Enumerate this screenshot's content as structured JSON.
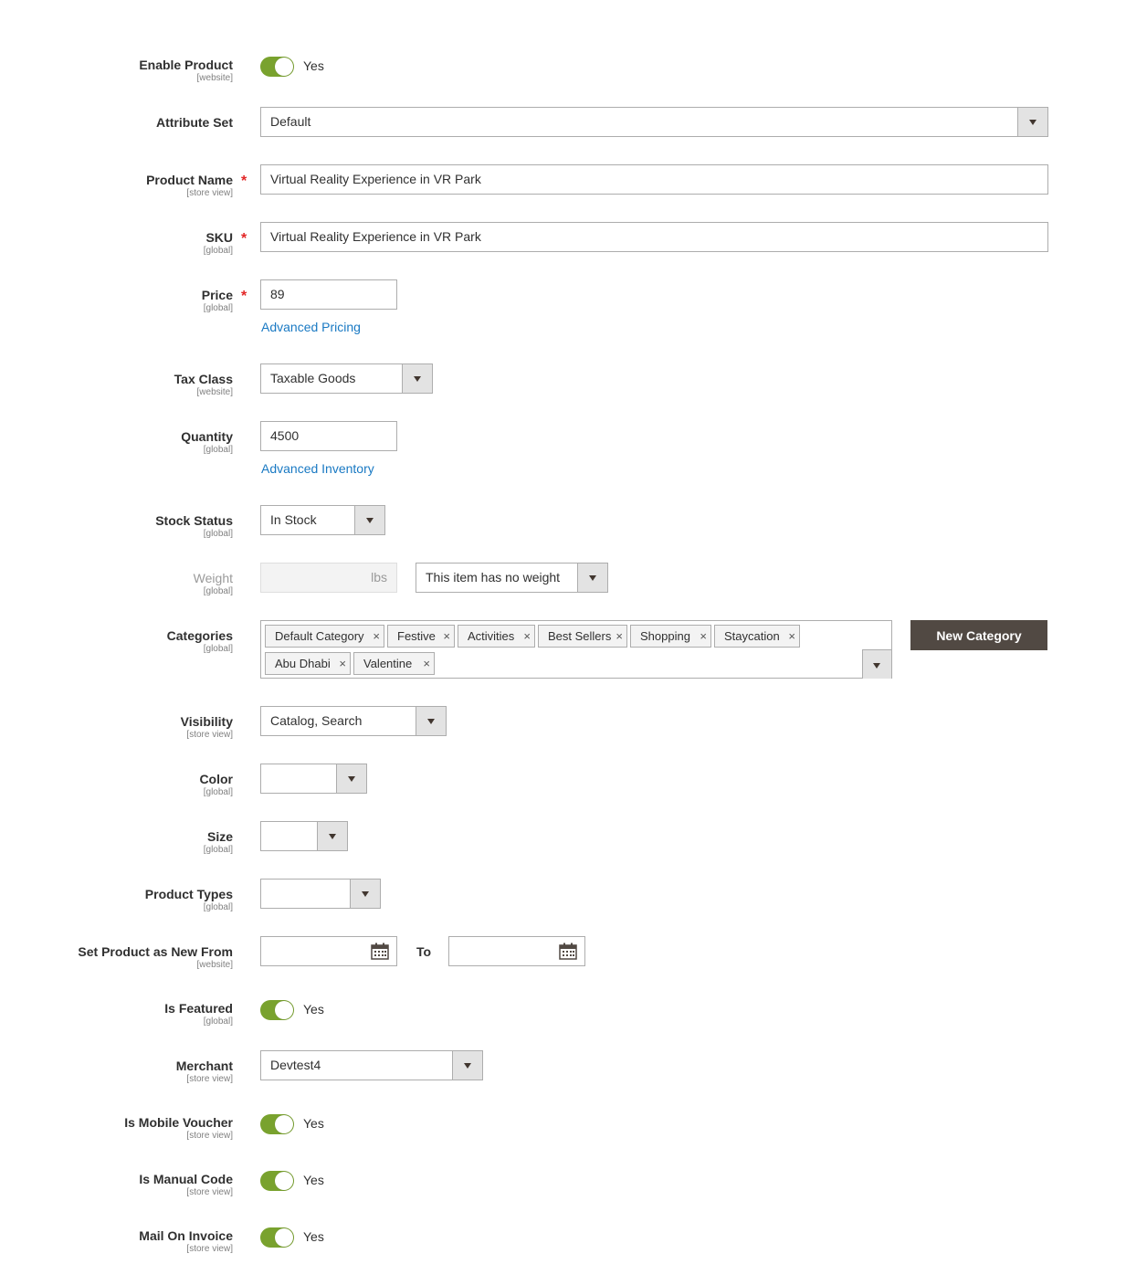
{
  "fields": {
    "enable_product": {
      "label": "Enable Product",
      "scope": "[website]",
      "toggle_text": "Yes"
    },
    "attribute_set": {
      "label": "Attribute Set",
      "value": "Default"
    },
    "product_name": {
      "label": "Product Name",
      "scope": "[store view]",
      "required_mark": "*",
      "value": "Virtual Reality Experience in VR Park"
    },
    "sku": {
      "label": "SKU",
      "scope": "[global]",
      "required_mark": "*",
      "value": "Virtual Reality Experience in VR Park"
    },
    "price": {
      "label": "Price",
      "scope": "[global]",
      "required_mark": "*",
      "value": "89",
      "link": "Advanced Pricing"
    },
    "tax_class": {
      "label": "Tax Class",
      "scope": "[website]",
      "value": "Taxable Goods"
    },
    "quantity": {
      "label": "Quantity",
      "scope": "[global]",
      "value": "4500",
      "link": "Advanced Inventory"
    },
    "stock_status": {
      "label": "Stock Status",
      "scope": "[global]",
      "value": "In Stock"
    },
    "weight": {
      "label": "Weight",
      "scope": "[global]",
      "unit": "lbs",
      "has_weight_value": "This item has no weight"
    },
    "categories": {
      "label": "Categories",
      "scope": "[global]",
      "chips": [
        "Default Category",
        "Festive",
        "Activities",
        "Best Sellers",
        "Shopping",
        "Staycation",
        "Abu Dhabi",
        "Valentine"
      ],
      "chip_remove": "×",
      "new_button": "New Category"
    },
    "visibility": {
      "label": "Visibility",
      "scope": "[store view]",
      "value": "Catalog, Search"
    },
    "color": {
      "label": "Color",
      "scope": "[global]",
      "value": ""
    },
    "size": {
      "label": "Size",
      "scope": "[global]",
      "value": ""
    },
    "product_types": {
      "label": "Product Types",
      "scope": "[global]",
      "value": ""
    },
    "new_from": {
      "label": "Set Product as New From",
      "scope": "[website]",
      "to_label": "To"
    },
    "is_featured": {
      "label": "Is Featured",
      "scope": "[global]",
      "toggle_text": "Yes"
    },
    "merchant": {
      "label": "Merchant",
      "scope": "[store view]",
      "value": "Devtest4"
    },
    "is_mobile_voucher": {
      "label": "Is Mobile Voucher",
      "scope": "[store view]",
      "toggle_text": "Yes"
    },
    "is_manual_code": {
      "label": "Is Manual Code",
      "scope": "[store view]",
      "toggle_text": "Yes"
    },
    "mail_on_invoice": {
      "label": "Mail On Invoice",
      "scope": "[store view]",
      "toggle_text": "Yes"
    }
  },
  "colors": {
    "toggle_on": "#79a22e",
    "link": "#1979c3",
    "required": "#e22626",
    "dark_button": "#514943"
  },
  "icons": {
    "dropdown": "chevron-down-icon",
    "calendar": "calendar-icon",
    "remove": "close-icon"
  }
}
